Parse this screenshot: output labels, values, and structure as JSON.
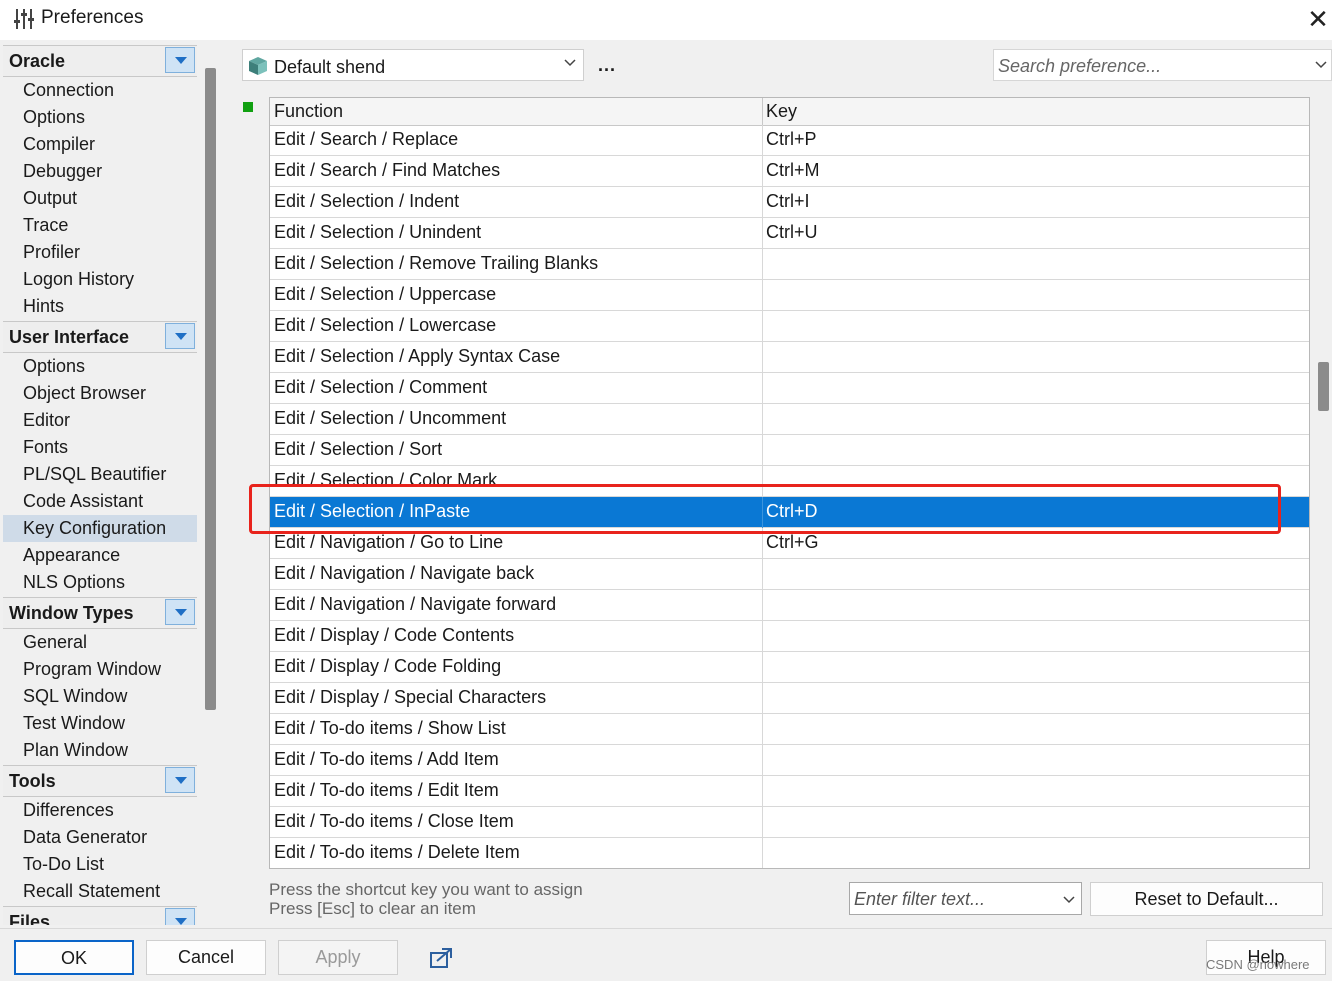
{
  "window": {
    "title": "Preferences",
    "close_glyph": "✕"
  },
  "sidebar": {
    "groups": [
      {
        "label": "Oracle",
        "items": [
          "Connection",
          "Options",
          "Compiler",
          "Debugger",
          "Output",
          "Trace",
          "Profiler",
          "Logon History",
          "Hints"
        ]
      },
      {
        "label": "User Interface",
        "items": [
          "Options",
          "Object Browser",
          "Editor",
          "Fonts",
          "PL/SQL Beautifier",
          "Code Assistant",
          "Key Configuration",
          "Appearance",
          "NLS Options"
        ]
      },
      {
        "label": "Window Types",
        "items": [
          "General",
          "Program Window",
          "SQL Window",
          "Test Window",
          "Plan Window"
        ]
      },
      {
        "label": "Tools",
        "items": [
          "Differences",
          "Data Generator",
          "To-Do List",
          "Recall Statement"
        ]
      },
      {
        "label": "Files",
        "items": []
      }
    ],
    "selected_item": "Key Configuration"
  },
  "toolbar": {
    "profile": "Default shend",
    "more_label": "...",
    "search_placeholder": "Search preference..."
  },
  "table": {
    "columns": [
      "Function",
      "Key"
    ],
    "rows": [
      {
        "function": "Edit / Search / Replace",
        "key": "Ctrl+P"
      },
      {
        "function": "Edit / Search / Find Matches",
        "key": "Ctrl+M"
      },
      {
        "function": "Edit / Selection / Indent",
        "key": "Ctrl+I"
      },
      {
        "function": "Edit / Selection / Unindent",
        "key": "Ctrl+U"
      },
      {
        "function": "Edit / Selection / Remove Trailing Blanks",
        "key": ""
      },
      {
        "function": "Edit / Selection / Uppercase",
        "key": ""
      },
      {
        "function": "Edit / Selection / Lowercase",
        "key": ""
      },
      {
        "function": "Edit / Selection / Apply Syntax Case",
        "key": ""
      },
      {
        "function": "Edit / Selection / Comment",
        "key": ""
      },
      {
        "function": "Edit / Selection / Uncomment",
        "key": ""
      },
      {
        "function": "Edit / Selection / Sort",
        "key": ""
      },
      {
        "function": "Edit / Selection / Color Mark",
        "key": ""
      },
      {
        "function": "Edit / Selection / InPaste",
        "key": "Ctrl+D"
      },
      {
        "function": "Edit / Navigation / Go to Line",
        "key": "Ctrl+G"
      },
      {
        "function": "Edit / Navigation / Navigate back",
        "key": ""
      },
      {
        "function": "Edit / Navigation / Navigate forward",
        "key": ""
      },
      {
        "function": "Edit / Display / Code Contents",
        "key": ""
      },
      {
        "function": "Edit / Display / Code Folding",
        "key": ""
      },
      {
        "function": "Edit / Display / Special Characters",
        "key": ""
      },
      {
        "function": "Edit / To-do items / Show List",
        "key": ""
      },
      {
        "function": "Edit / To-do items / Add Item",
        "key": ""
      },
      {
        "function": "Edit / To-do items / Edit Item",
        "key": ""
      },
      {
        "function": "Edit / To-do items / Close Item",
        "key": ""
      },
      {
        "function": "Edit / To-do items / Delete Item",
        "key": ""
      }
    ],
    "selected_row": "Edit / Selection / InPaste"
  },
  "footer": {
    "hint_line1": "Press the shortcut key you want to assign",
    "hint_line2": "Press [Esc] to clear an item",
    "filter_placeholder": "Enter filter text...",
    "reset_label": "Reset to Default..."
  },
  "buttons": {
    "ok": "OK",
    "cancel": "Cancel",
    "apply": "Apply",
    "help": "Help"
  },
  "watermark": "CSDN @nowhere",
  "colors": {
    "selection": "#0a78d4",
    "highlight_box": "#e8231c",
    "marker": "#11a011"
  }
}
